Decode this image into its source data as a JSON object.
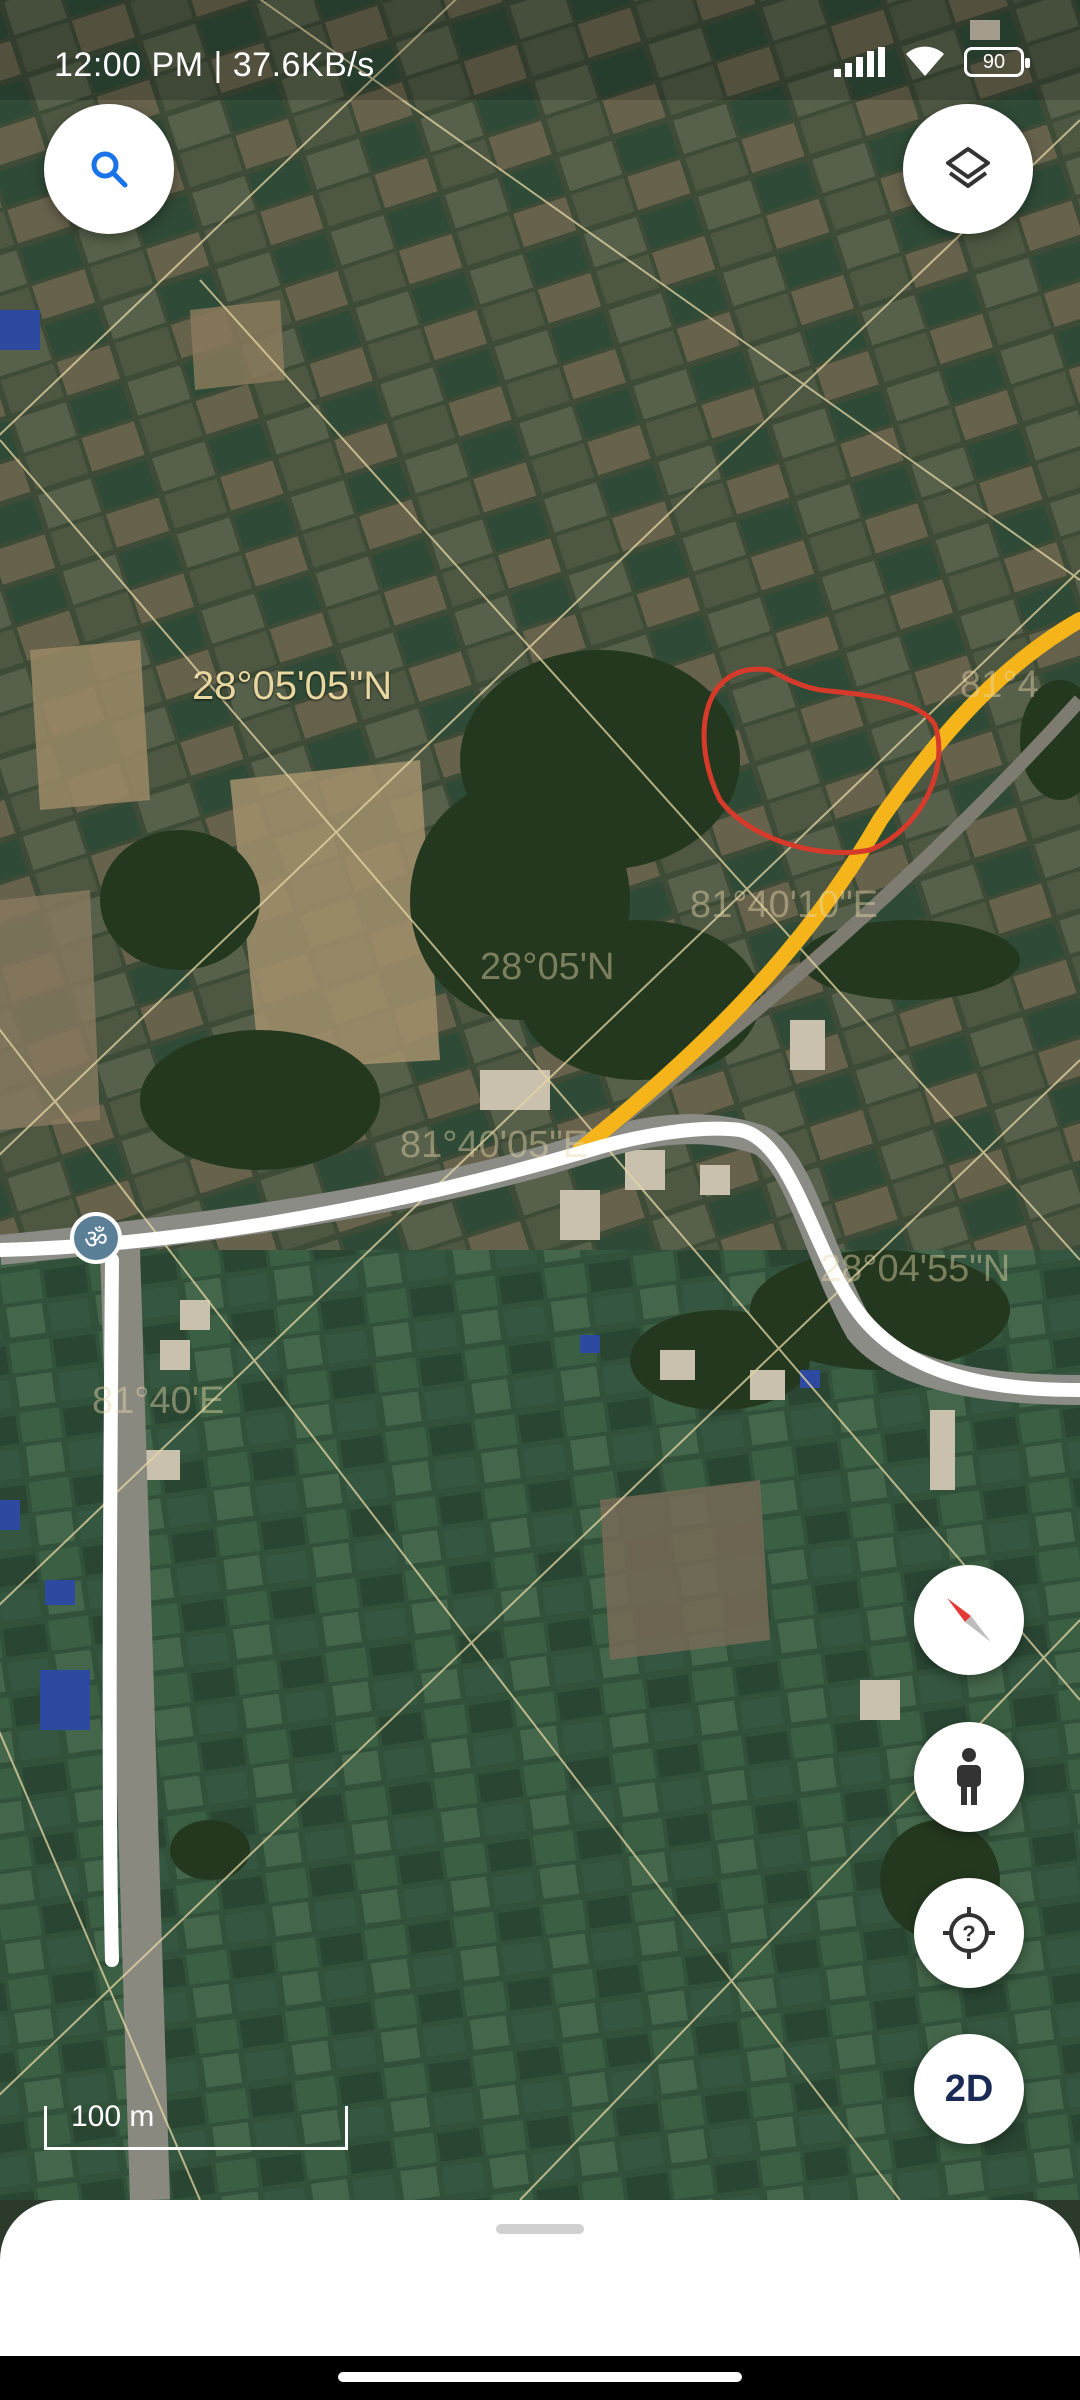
{
  "status_bar": {
    "time_speed": "12:00 PM | 37.6KB/s",
    "battery": "90"
  },
  "map": {
    "coordinate_labels": {
      "lat_main": "28°05'05\"N",
      "lon_right_top": "81°4",
      "lon_mid": "81°40'10\"E",
      "lat_mid": "28°05'N",
      "lon_lower": "81°40'05\"E",
      "lat_lower_right": "28°04'55\"N",
      "lon_left": "81°40'E"
    },
    "poi_glyph": "ॐ",
    "scale_label": "100 m"
  },
  "controls": {
    "search_icon": "search-icon",
    "layers_icon": "layers-icon",
    "compass_icon": "compass-icon",
    "street_view_icon": "pegman-icon",
    "location_icon": "my-location-icon",
    "view_mode_label": "2D"
  },
  "colors": {
    "route_white": "#ffffff",
    "route_yellow": "#f4b41a",
    "annotation_red": "#d63a2a",
    "grid_line": "#e6d8a6"
  }
}
